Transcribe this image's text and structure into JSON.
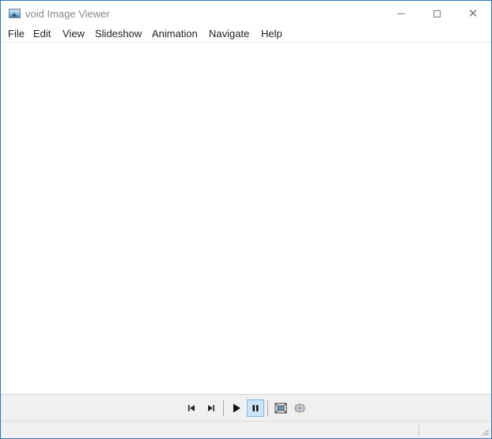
{
  "window": {
    "title": "void Image Viewer"
  },
  "menu": {
    "items": [
      "File",
      "Edit",
      "View",
      "Slideshow",
      "Animation",
      "Navigate",
      "Help"
    ]
  },
  "toolbar": {
    "buttons": [
      {
        "name": "previous-icon"
      },
      {
        "name": "next-icon"
      },
      {
        "name": "play-icon"
      },
      {
        "name": "pause-icon",
        "active": true
      },
      {
        "name": "best-fit-icon"
      },
      {
        "name": "actual-size-icon"
      }
    ]
  },
  "colors": {
    "accent": "#2b79c2",
    "active_button": "#cce4f7",
    "toolbar_bg": "#f0f0f0"
  }
}
